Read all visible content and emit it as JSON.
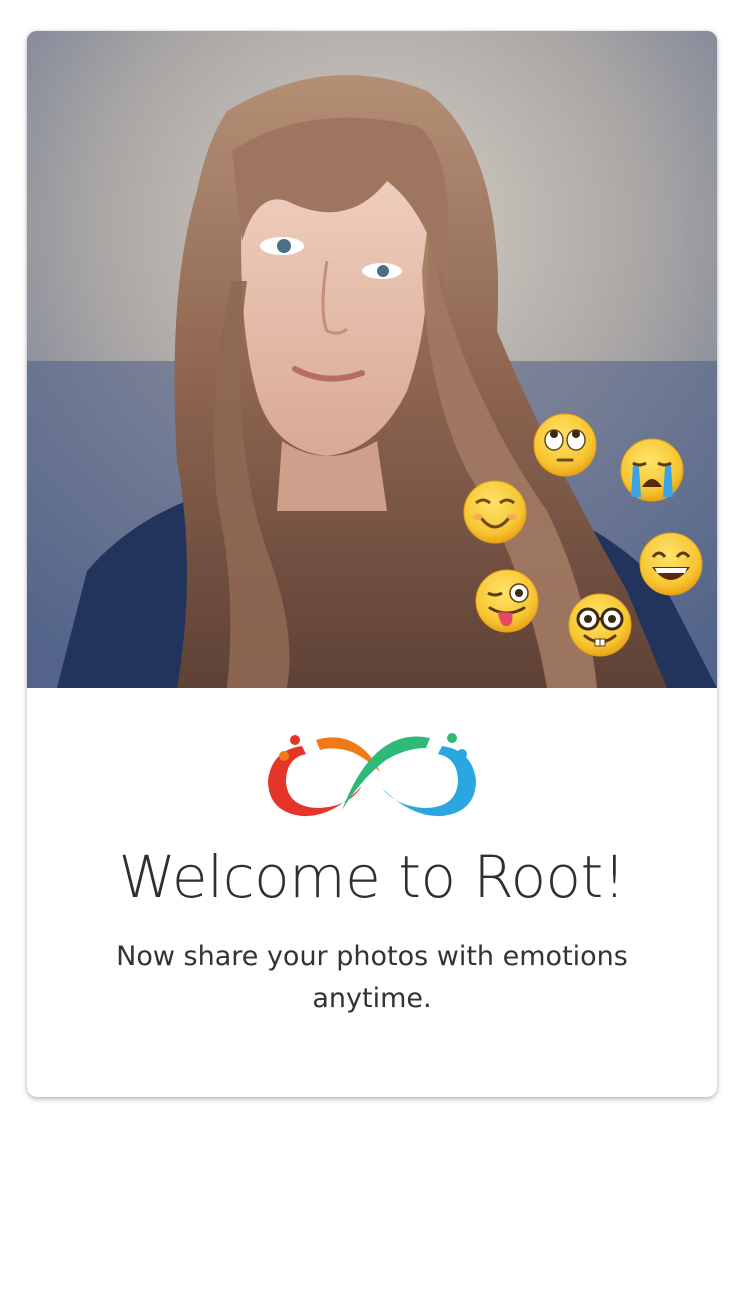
{
  "welcome_card": {
    "photo": {
      "description_icon": "portrait-photo",
      "emojis": [
        {
          "name": "eye-roll-emoji-icon"
        },
        {
          "name": "crying-emoji-icon"
        },
        {
          "name": "relieved-emoji-icon"
        },
        {
          "name": "grin-emoji-icon"
        },
        {
          "name": "tongue-wink-emoji-icon"
        },
        {
          "name": "nerd-emoji-icon"
        }
      ]
    },
    "logo": {
      "icon": "infinity-logo-icon"
    },
    "title": "Welcome to Root!",
    "subtitle": "Now share your photos with emotions anytime."
  },
  "colors": {
    "background": "#ffffff",
    "title_text": "#2f2f2f",
    "body_text": "#333333",
    "logo_red": "#e5352a",
    "logo_orange": "#f07a1a",
    "logo_green": "#2fb978",
    "logo_blue": "#2aa6e0",
    "emoji_yellow": "#f7c531"
  }
}
